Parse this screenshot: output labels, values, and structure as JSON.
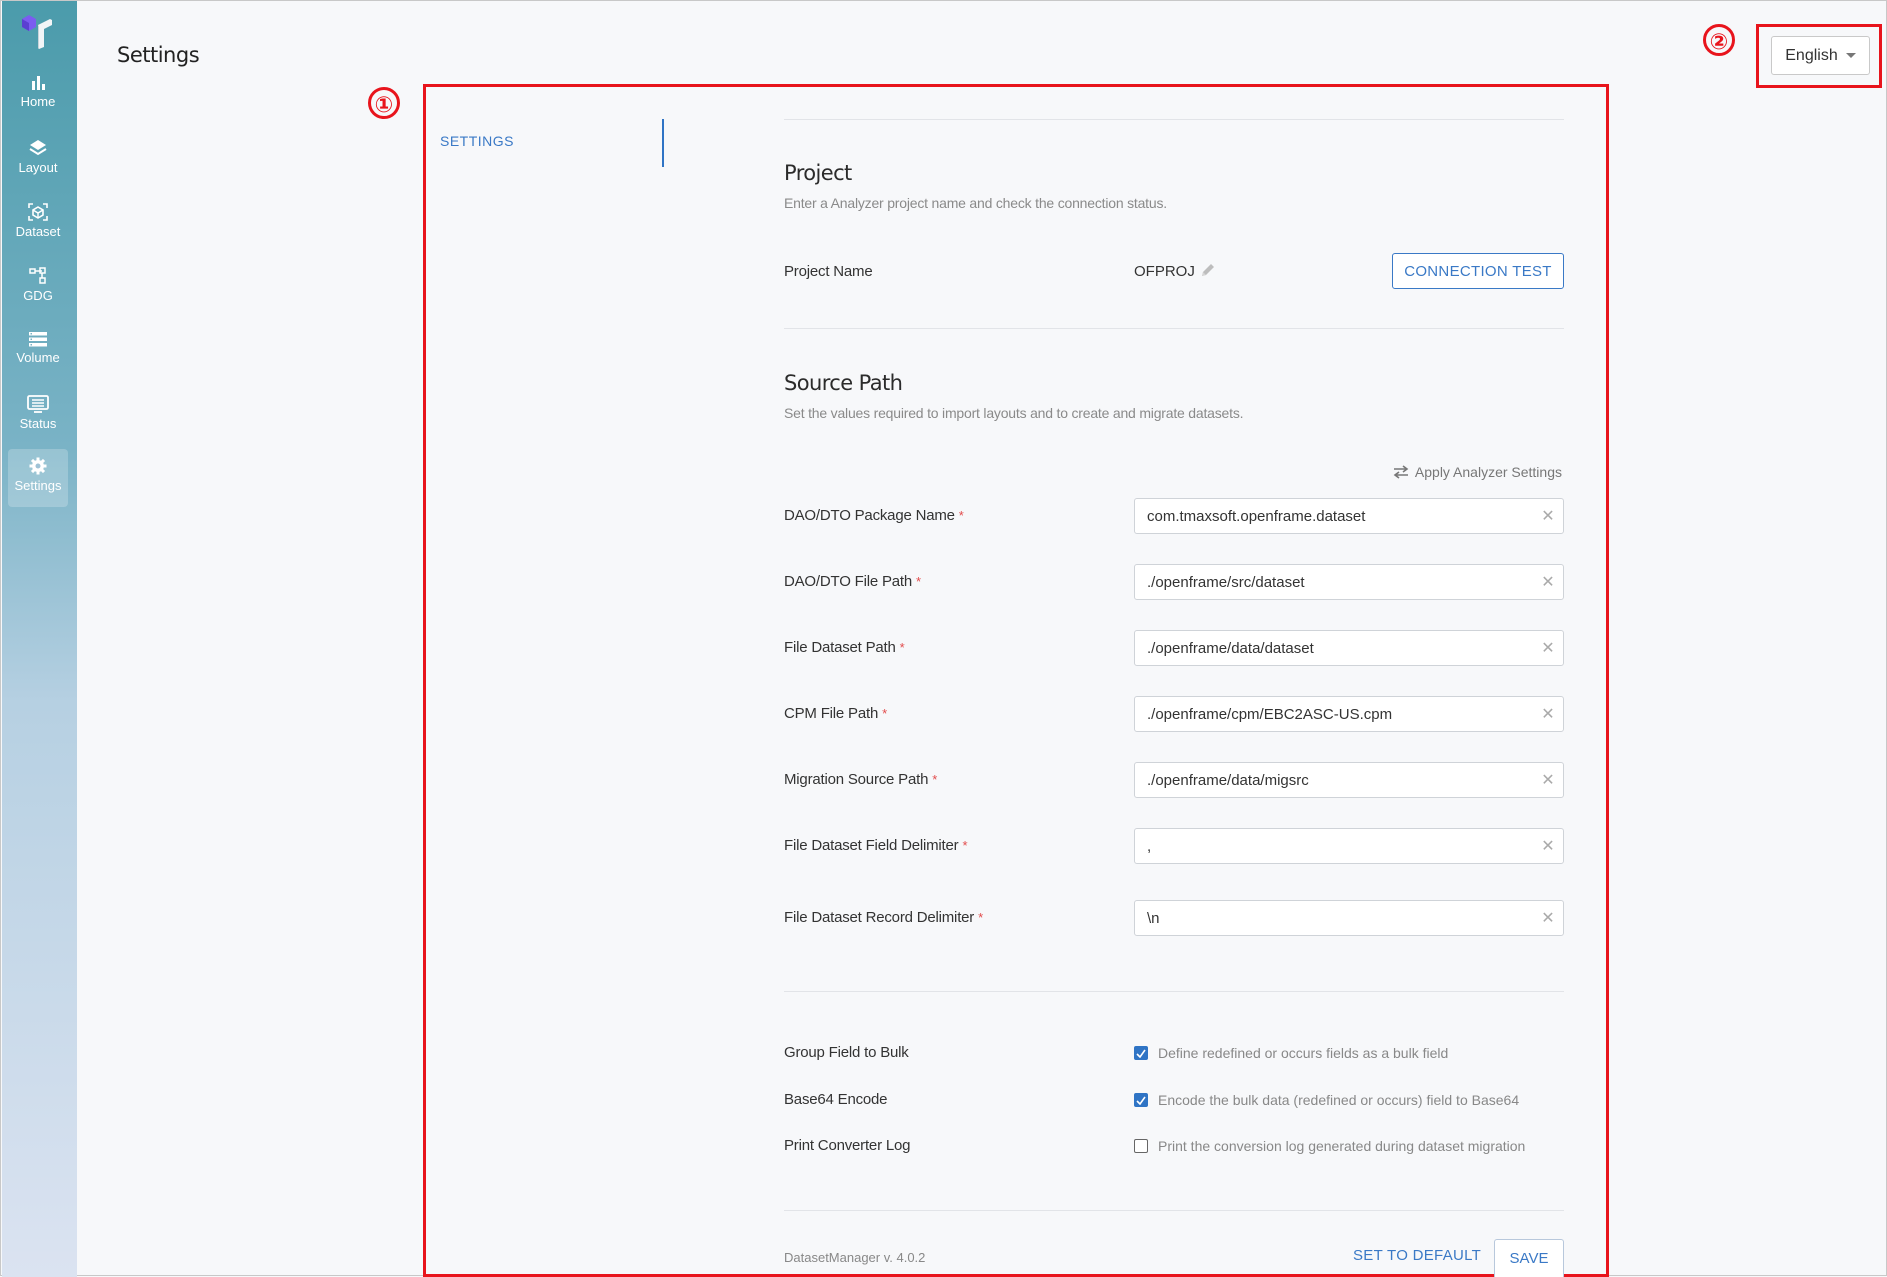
{
  "sidebar": {
    "logo": "tmax-logo-icon",
    "items": [
      {
        "label": "Home",
        "icon": "bar-chart-icon",
        "active": false
      },
      {
        "label": "Layout",
        "icon": "layers-icon",
        "active": false
      },
      {
        "label": "Dataset",
        "icon": "cube-scan-icon",
        "active": false
      },
      {
        "label": "GDG",
        "icon": "tree-nodes-icon",
        "active": false
      },
      {
        "label": "Volume",
        "icon": "list-stack-icon",
        "active": false
      },
      {
        "label": "Status",
        "icon": "monitor-list-icon",
        "active": false
      },
      {
        "label": "Settings",
        "icon": "gear-icon",
        "active": true
      }
    ]
  },
  "header": {
    "title": "Settings",
    "language": {
      "selected": "English"
    }
  },
  "annotations": {
    "main_area": "①",
    "language": "②",
    "color": "#e8141c"
  },
  "tabs": [
    {
      "label": "SETTINGS",
      "active": true
    }
  ],
  "project": {
    "title": "Project",
    "description": "Enter a Analyzer project name and check the connection status.",
    "name_label": "Project Name",
    "name_value": "OFPROJ",
    "connection_test_label": "CONNECTION TEST"
  },
  "source_path": {
    "title": "Source Path",
    "description": "Set the values required to import layouts and to create and migrate datasets.",
    "apply_label": "Apply Analyzer Settings",
    "fields": [
      {
        "label": "DAO/DTO Package Name",
        "required": "*",
        "value": "com.tmaxsoft.openframe.dataset"
      },
      {
        "label": "DAO/DTO File Path",
        "required": "*",
        "value": "./openframe/src/dataset"
      },
      {
        "label": "File Dataset Path",
        "required": "*",
        "value": "./openframe/data/dataset"
      },
      {
        "label": "CPM File Path",
        "required": "*",
        "value": "./openframe/cpm/EBC2ASC-US.cpm"
      },
      {
        "label": "Migration Source Path",
        "required": "*",
        "value": "./openframe/data/migsrc"
      },
      {
        "label": "File Dataset Field Delimiter",
        "required": "*",
        "value": ","
      },
      {
        "label": "File Dataset Record Delimiter",
        "required": "*",
        "value": "\\n"
      }
    ]
  },
  "options": [
    {
      "label": "Group Field to Bulk",
      "checked": true,
      "description": "Define redefined or occurs fields as a bulk field"
    },
    {
      "label": "Base64 Encode",
      "checked": true,
      "description": "Encode the bulk data (redefined or occurs) field to Base64"
    },
    {
      "label": "Print Converter Log",
      "checked": false,
      "description": "Print the conversion log generated during dataset migration"
    }
  ],
  "footer": {
    "version": "DatasetManager v. 4.0.2",
    "set_default_label": "SET TO DEFAULT",
    "save_label": "SAVE"
  },
  "colors": {
    "accent": "#3a79c6",
    "sidebar_top": "#4b9bab",
    "sidebar_bottom": "#dbe3f1",
    "required": "#e24b4b"
  }
}
